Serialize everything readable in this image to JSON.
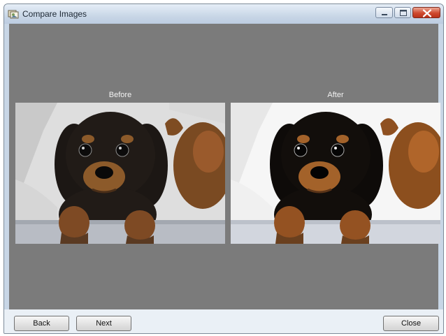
{
  "window": {
    "title": "Compare Images",
    "icons": {
      "app": "app-icon",
      "minimize": "minimize-icon",
      "maximize": "maximize-icon",
      "close": "close-icon"
    }
  },
  "compare": {
    "before_label": "Before",
    "after_label": "After",
    "before_image": "puppy-photo-original",
    "after_image": "puppy-photo-corrected"
  },
  "buttons": {
    "back": "Back",
    "next": "Next",
    "close": "Close"
  },
  "colors": {
    "client_background": "#7b7b7b",
    "titlebar": "#c9d7e7",
    "close_button": "#cf4a2f",
    "bottom_bar": "#eaf0f6"
  }
}
